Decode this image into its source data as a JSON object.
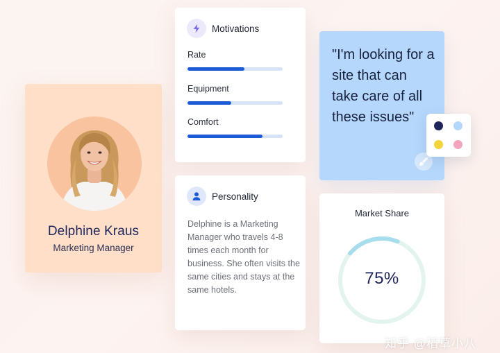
{
  "profile": {
    "name": "Delphine Kraus",
    "role": "Marketing Manager"
  },
  "motivations": {
    "title": "Motivations",
    "icon": "lightning-icon",
    "items": [
      {
        "label": "Rate",
        "value": 0.6
      },
      {
        "label": "Equipment",
        "value": 0.46
      },
      {
        "label": "Comfort",
        "value": 0.79
      }
    ]
  },
  "personality": {
    "title": "Personality",
    "icon": "user-icon",
    "text": "Delphine is a Marketing Manager who travels 4-8 times each month for business. She often visits the same cities and stays at the same hotels."
  },
  "quote": {
    "text": "\"I'm looking for a site that can take care of all these issues\"",
    "icon": "paint-brush-icon"
  },
  "palette": {
    "colors": [
      "#1d2459",
      "#b5d7fc",
      "#f4d33a",
      "#f2a6bd"
    ]
  },
  "market_share": {
    "title": "Market Share",
    "value_label": "75%",
    "value": 0.75
  },
  "watermark": {
    "text": "知乎 @稻草小八"
  },
  "colors": {
    "accent": "#1c5bd6",
    "profile_bg": "#ffdfc8",
    "quote_bg": "#b5d7fc",
    "heading": "#1d2459"
  }
}
